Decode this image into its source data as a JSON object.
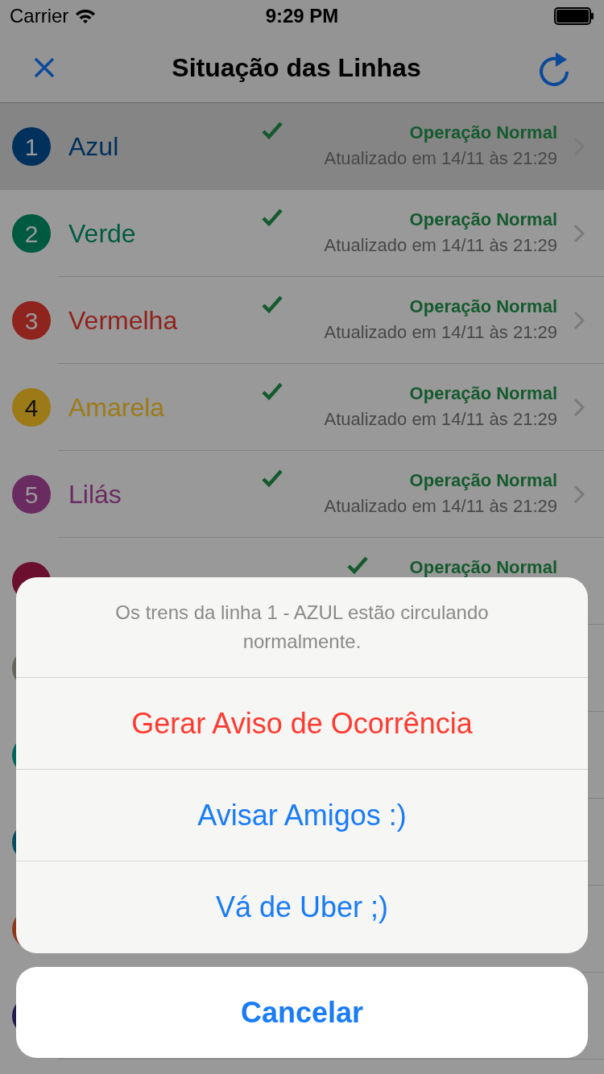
{
  "status_bar": {
    "carrier": "Carrier",
    "time": "9:29 PM"
  },
  "nav": {
    "title": "Situação das Linhas"
  },
  "lines": [
    {
      "number": "1",
      "name": "Azul",
      "color": "#00305c",
      "status": "Operação Normal",
      "updated": "Atualizado em 14/11 às 21:29",
      "selected": true
    },
    {
      "number": "2",
      "name": "Verde",
      "color": "#005a40",
      "status": "Operação Normal",
      "updated": "Atualizado em 14/11 às 21:29",
      "selected": false
    },
    {
      "number": "3",
      "name": "Vermelha",
      "color": "#8f231e",
      "status": "Operação Normal",
      "updated": "Atualizado em 14/11 às 21:29",
      "selected": false
    },
    {
      "number": "4",
      "name": "Amarela",
      "color": "#9c7a18",
      "status": "Operação Normal",
      "updated": "Atualizado em 14/11 às 21:29",
      "selected": false
    },
    {
      "number": "5",
      "name": "Lilás",
      "color": "#6a2b61",
      "status": "Operação Normal",
      "updated": "Atualizado em 14/11 às 21:29",
      "selected": false
    },
    {
      "color": "#6a0f2e",
      "status": "Operação Normal"
    },
    {
      "color": "#65635a"
    },
    {
      "color": "#00655c"
    },
    {
      "color": "#064c60"
    },
    {
      "color": "#90361a"
    },
    {
      "color": "#261950"
    }
  ],
  "action_sheet": {
    "message": "Os trens da linha 1 - AZUL estão circulando normalmente.",
    "actions": [
      {
        "label": "Gerar Aviso de Ocorrência",
        "kind": "destructive"
      },
      {
        "label": "Avisar Amigos :)",
        "kind": "default"
      },
      {
        "label": "Vá de Uber ;)",
        "kind": "default"
      }
    ],
    "cancel": "Cancelar"
  }
}
